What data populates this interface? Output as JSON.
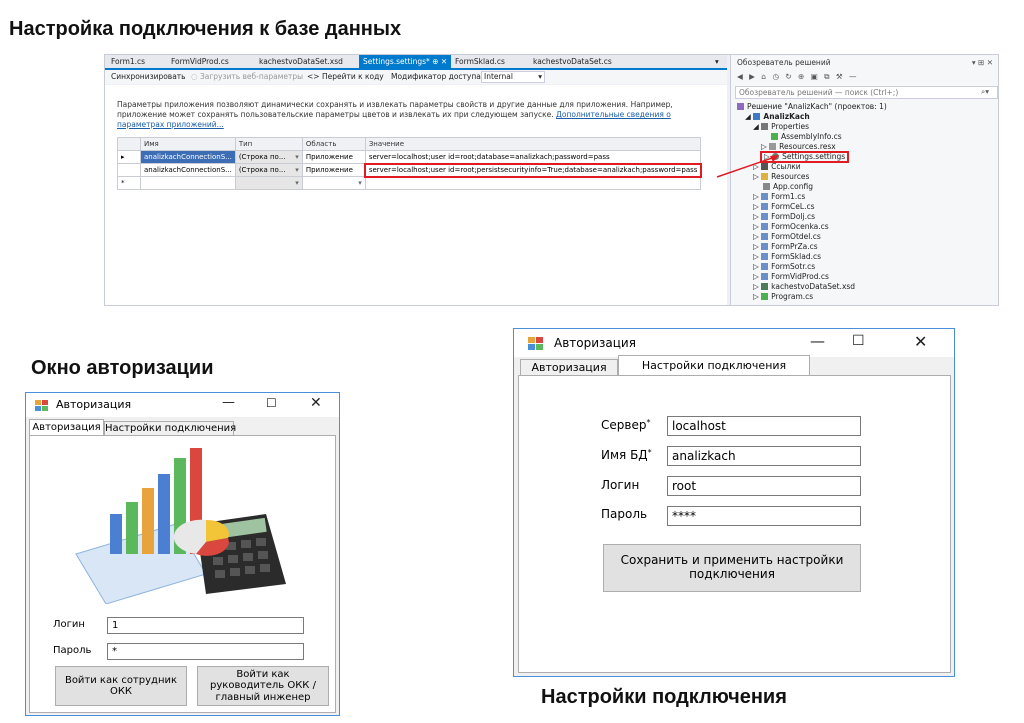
{
  "headings": {
    "main": "Настройка подключения к базе данных",
    "auth": "Окно авторизации",
    "conn": "Настройки подключения"
  },
  "vs": {
    "tabs": [
      "Form1.cs",
      "FormVidProd.cs",
      "kachestvoDataSet.xsd",
      "Settings.settings*",
      "FormSklad.cs",
      "kachestvoDataSet.cs"
    ],
    "toolbar": {
      "sync": "Синхронизировать",
      "load": "Загрузить веб-параметры",
      "goto": "<> Перейти к коду",
      "access_label": "Модификатор доступа:",
      "access_value": "Internal"
    },
    "description": "Параметры приложения позволяют динамически сохранять и извлекать параметры свойств и другие данные для приложения. Например, приложение может сохранять пользовательские параметры цветов и извлекать их при следующем запуске.",
    "description_link": "Дополнительные сведения о параметрах приложений...",
    "columns": [
      "Имя",
      "Тип",
      "Область",
      "Значение"
    ],
    "rows": [
      {
        "marker": "▸",
        "name": "analizkachConnectionS...",
        "type": "(Строка по...",
        "scope": "Приложение",
        "value": "server=localhost;user id=root;database=analizkach;password=pass"
      },
      {
        "marker": "",
        "name": "analizkachConnectionS...",
        "type": "(Строка по...",
        "scope": "Приложение",
        "value": "server=localhost;user id=root;persistsecurityinfo=True;database=analizkach;password=pass"
      },
      {
        "marker": "*",
        "name": "",
        "type": "",
        "scope": "",
        "value": ""
      }
    ],
    "solution_explorer": {
      "title": "Обозреватель решений",
      "search_placeholder": "Обозреватель решений — поиск (Ctrl+;)",
      "items": [
        "Решение \"AnalizKach\" (проектов: 1)",
        "AnalizKach",
        "Properties",
        "AssemblyInfo.cs",
        "Resources.resx",
        "Settings.settings",
        "Ссылки",
        "Resources",
        "App.config",
        "Form1.cs",
        "FormCeL.cs",
        "FormDolj.cs",
        "FormOcenka.cs",
        "FormOtdel.cs",
        "FormPrZa.cs",
        "FormSklad.cs",
        "FormSotr.cs",
        "FormVidProd.cs",
        "kachestvoDataSet.xsd",
        "Program.cs"
      ]
    }
  },
  "auth_window": {
    "title": "Авторизация",
    "tabs": [
      "Авторизация",
      "Настройки подключения"
    ],
    "login_label": "Логин",
    "login_value": "1",
    "password_label": "Пароль",
    "password_value": "*",
    "btn_employee": "Войти как сотрудник ОКК",
    "btn_manager": "Войти как руководитель ОКК / главный инженер"
  },
  "conn_window": {
    "title": "Авторизация",
    "tabs": [
      "Авторизация",
      "Настройки подключения"
    ],
    "server_label": "Сервер",
    "server_value": "localhost",
    "db_label": "Имя БД",
    "db_value": "analizkach",
    "login_label": "Логин",
    "login_value": "root",
    "password_label": "Пароль",
    "password_value": "****",
    "save_button": "Сохранить и применить настройки подключения"
  },
  "colors": {
    "accent": "#007acc",
    "highlight": "#e01b24",
    "window_border": "#4a90d9"
  }
}
